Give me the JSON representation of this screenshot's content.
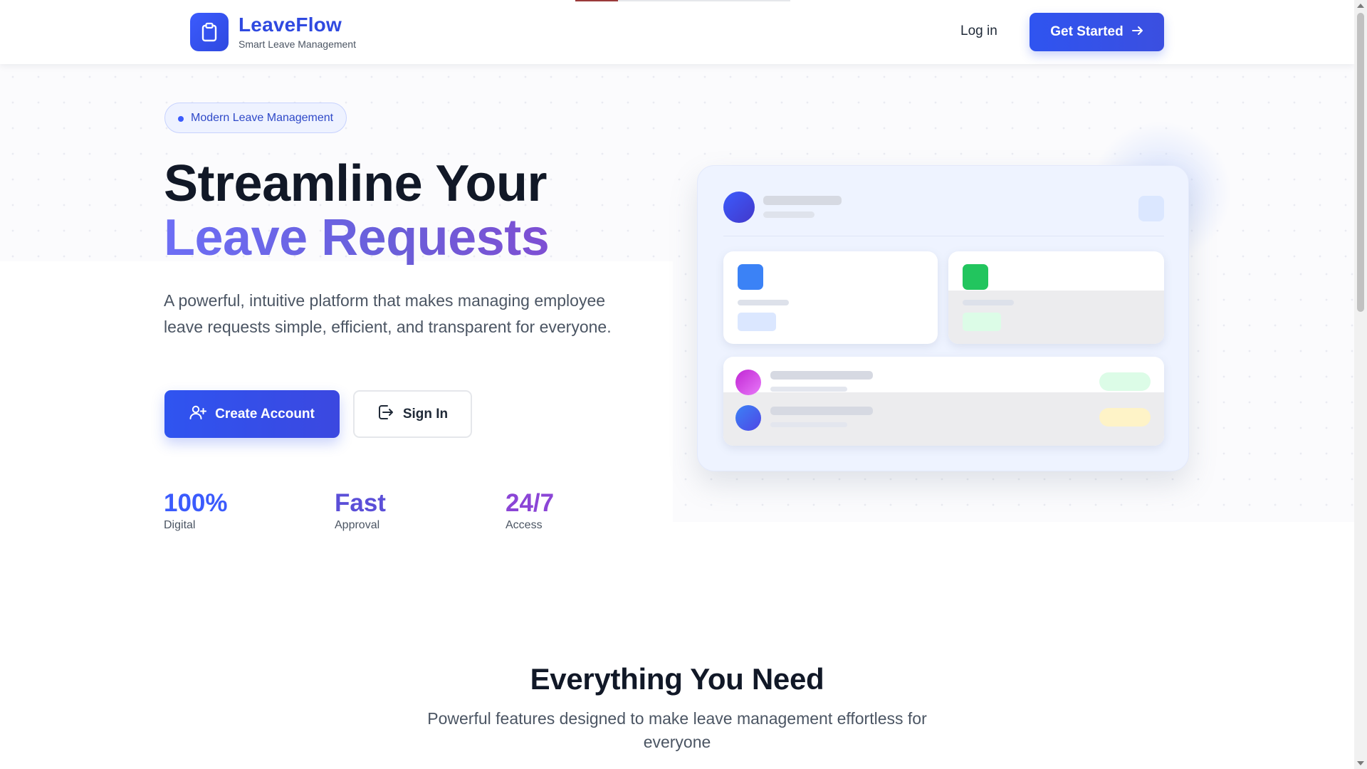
{
  "header": {
    "brand_name": "LeaveFlow",
    "brand_tagline": "Smart Leave Management",
    "brand_icon": "clipboard-icon",
    "login_label": "Log in",
    "get_started_label": "Get Started",
    "get_started_icon": "arrow-right-icon"
  },
  "hero": {
    "badge": "Modern Leave Management",
    "title_line1": "Streamline Your",
    "title_line2": "Leave Requests",
    "description": "A powerful, intuitive platform that makes managing employee leave requests simple, efficient, and transparent for everyone.",
    "create_account_label": "Create Account",
    "create_account_icon": "user-plus-icon",
    "sign_in_label": "Sign In",
    "sign_in_icon": "sign-in-icon",
    "stats": [
      {
        "value": "100%",
        "label": "Digital",
        "color": "#3b5bfd"
      },
      {
        "value": "Fast",
        "label": "Approval",
        "color": "#5b4fd8"
      },
      {
        "value": "24/7",
        "label": "Access",
        "color": "#8b45d6"
      }
    ]
  },
  "features": {
    "title": "Everything You Need",
    "subtitle": "Powerful features designed to make leave management effortless for everyone"
  },
  "colors": {
    "accent": "#2f54f0",
    "brand": "#2f49e0",
    "title_gradient_start": "#6d6ef5",
    "title_gradient_end": "#7e4fd3",
    "mock_green": "#22c55e",
    "mock_blue": "#3b82f6",
    "mock_yellow": "#fef3c7"
  }
}
